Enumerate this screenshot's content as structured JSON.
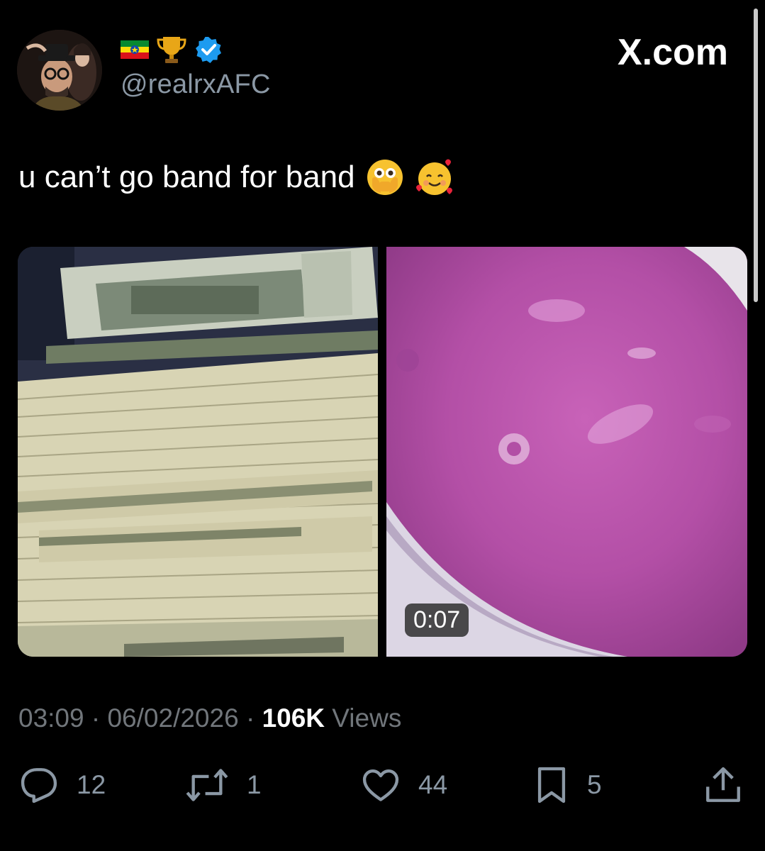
{
  "header": {
    "handle": "@realrxAFC",
    "site": "X.com",
    "badges": [
      "ethiopia-flag-icon",
      "trophy-icon",
      "verified-badge-icon"
    ]
  },
  "tweet": {
    "text": "u can’t go band for band",
    "emojis": [
      "face-with-open-eyes-and-hand-over-mouth-icon",
      "smiling-face-with-hearts-icon"
    ]
  },
  "media": {
    "left": "photo of stacked cash bills",
    "right_duration": "0:07"
  },
  "meta": {
    "time": "03:09",
    "sep1": "·",
    "date": "06/02/2026",
    "sep2": "·",
    "views_count": "106K",
    "views_label": "Views"
  },
  "actions": {
    "replies": "12",
    "reposts": "1",
    "likes": "44",
    "bookmarks": "5"
  },
  "colors": {
    "background": "#000000",
    "text": "#ffffff",
    "muted": "#71767b",
    "verified": "#1d9bf0"
  }
}
